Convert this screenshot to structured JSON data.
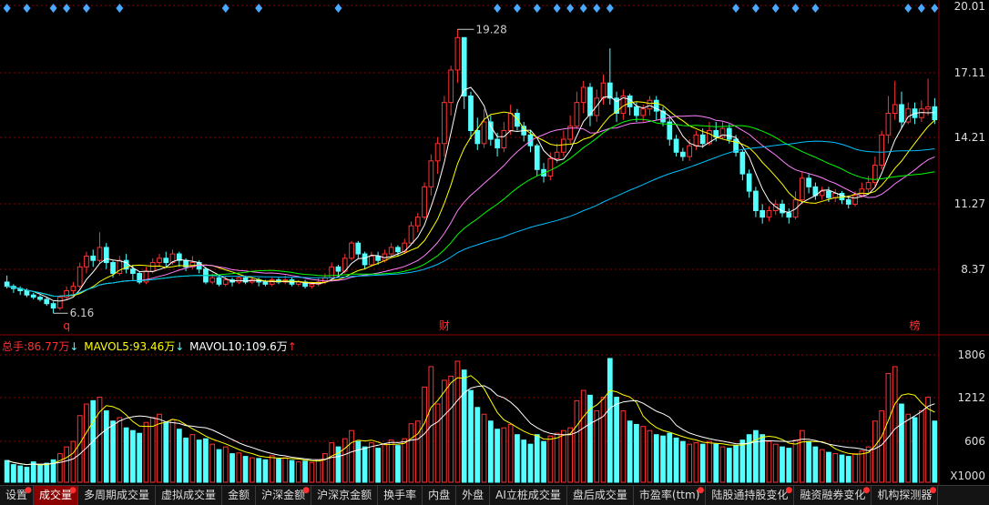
{
  "header": {
    "stock_name": "",
    "tag": ""
  },
  "price_axis": [
    "20.01",
    "17.11",
    "14.21",
    "11.27",
    "8.37"
  ],
  "volume_axis": [
    "1806",
    "1212",
    "606",
    "X1000"
  ],
  "markers": {
    "high": "19.28",
    "low": "6.16",
    "bottom_q": "q",
    "bottom_cai": "财",
    "bottom_bang": "榜"
  },
  "volume_info": {
    "total_label": "总手:",
    "total_value": "86.77万",
    "total_arrow": "↓",
    "mavol5_label": "MAVOL5:",
    "mavol5_value": "93.46万",
    "mavol5_arrow": "↓",
    "mavol10_label": "MAVOL10:",
    "mavol10_value": "109.6万",
    "mavol10_arrow": "↑"
  },
  "colors": {
    "up": "#ff3232",
    "down": "#54ffff",
    "ma5": "#ffffff",
    "ma10": "#ffff00",
    "ma20": "#ff80ff",
    "ma30": "#00ff00",
    "ma60": "#00bfff",
    "grid": "#8b0000",
    "diamond": "#4aa8ff"
  },
  "tabs": [
    {
      "label": "设置",
      "dot": true
    },
    {
      "label": "成交量",
      "dot": true,
      "active": true
    },
    {
      "label": "多周期成交量",
      "dot": false
    },
    {
      "label": "虚拟成交量",
      "dot": false
    },
    {
      "label": "金额",
      "dot": false
    },
    {
      "label": "沪深金额",
      "dot": true
    },
    {
      "label": "沪深京金额",
      "dot": false
    },
    {
      "label": "换手率",
      "dot": false
    },
    {
      "label": "内盘",
      "dot": false
    },
    {
      "label": "外盘",
      "dot": false
    },
    {
      "label": "AI立桩成交量",
      "dot": false
    },
    {
      "label": "盘后成交量",
      "dot": false
    },
    {
      "label": "市盈率(ttm)",
      "dot": true
    },
    {
      "label": "陆股通持股变化",
      "dot": true
    },
    {
      "label": "融资融券变化",
      "dot": true
    },
    {
      "label": "机构探测器",
      "dot": true
    }
  ],
  "chart_data": {
    "type": "candlestick",
    "price_range": [
      6.0,
      20.3
    ],
    "volume_range": [
      0,
      1900
    ],
    "candles": [
      [
        7.6,
        7.4,
        7.9,
        7.3,
        320
      ],
      [
        7.4,
        7.3,
        7.5,
        7.1,
        260
      ],
      [
        7.3,
        7.2,
        7.4,
        7.0,
        240
      ],
      [
        7.2,
        7.0,
        7.3,
        6.9,
        220
      ],
      [
        7.0,
        6.9,
        7.1,
        6.8,
        300
      ],
      [
        6.9,
        6.8,
        7.0,
        6.7,
        260
      ],
      [
        6.8,
        6.6,
        6.9,
        6.5,
        280
      ],
      [
        6.6,
        6.4,
        6.7,
        6.16,
        330
      ],
      [
        6.4,
        6.9,
        7.0,
        6.3,
        420
      ],
      [
        6.9,
        7.2,
        7.4,
        6.8,
        520
      ],
      [
        7.2,
        7.4,
        7.6,
        7.0,
        600
      ],
      [
        7.4,
        8.3,
        8.5,
        7.3,
        980
      ],
      [
        8.3,
        8.8,
        9.0,
        8.0,
        1150
      ],
      [
        8.8,
        8.6,
        9.1,
        8.3,
        1200
      ],
      [
        8.6,
        9.2,
        9.9,
        8.5,
        1250
      ],
      [
        9.2,
        8.5,
        9.4,
        8.2,
        1050
      ],
      [
        8.5,
        8.0,
        8.6,
        7.8,
        900
      ],
      [
        8.0,
        8.6,
        8.8,
        7.9,
        950
      ],
      [
        8.6,
        8.2,
        8.9,
        8.0,
        800
      ],
      [
        8.2,
        8.0,
        8.4,
        7.7,
        760
      ],
      [
        8.0,
        7.6,
        8.1,
        7.5,
        720
      ],
      [
        7.6,
        8.1,
        8.3,
        7.5,
        880
      ],
      [
        8.1,
        8.5,
        8.7,
        8.0,
        950
      ],
      [
        8.5,
        8.7,
        8.9,
        8.3,
        1000
      ],
      [
        8.7,
        8.5,
        9.0,
        8.3,
        880
      ],
      [
        8.5,
        8.9,
        9.1,
        8.4,
        920
      ],
      [
        8.9,
        8.6,
        9.0,
        8.3,
        780
      ],
      [
        8.6,
        8.3,
        8.7,
        8.1,
        650
      ],
      [
        8.3,
        8.5,
        8.8,
        8.2,
        700
      ],
      [
        8.5,
        8.2,
        8.6,
        8.0,
        620
      ],
      [
        8.2,
        7.6,
        8.3,
        7.5,
        640
      ],
      [
        7.6,
        7.8,
        8.0,
        7.5,
        560
      ],
      [
        7.8,
        7.5,
        7.9,
        7.4,
        480
      ],
      [
        7.5,
        7.7,
        7.9,
        7.4,
        520
      ],
      [
        7.7,
        7.6,
        7.8,
        7.4,
        420
      ],
      [
        7.6,
        7.8,
        7.9,
        7.5,
        430
      ],
      [
        7.8,
        7.6,
        7.9,
        7.5,
        380
      ],
      [
        7.6,
        7.7,
        7.8,
        7.5,
        360
      ],
      [
        7.7,
        7.6,
        7.8,
        7.4,
        350
      ],
      [
        7.6,
        7.5,
        7.7,
        7.4,
        330
      ],
      [
        7.5,
        7.7,
        7.8,
        7.4,
        390
      ],
      [
        7.7,
        7.6,
        7.8,
        7.5,
        340
      ],
      [
        7.6,
        7.7,
        7.9,
        7.5,
        360
      ],
      [
        7.7,
        7.5,
        7.8,
        7.4,
        320
      ],
      [
        7.5,
        7.6,
        7.7,
        7.4,
        300
      ],
      [
        7.6,
        7.4,
        7.7,
        7.3,
        310
      ],
      [
        7.4,
        7.5,
        7.6,
        7.3,
        290
      ],
      [
        7.5,
        7.6,
        7.8,
        7.4,
        330
      ],
      [
        7.6,
        7.8,
        8.0,
        7.5,
        420
      ],
      [
        7.8,
        8.3,
        8.5,
        7.7,
        580
      ],
      [
        8.3,
        8.1,
        8.4,
        7.9,
        520
      ],
      [
        8.1,
        8.7,
        8.9,
        8.0,
        640
      ],
      [
        8.7,
        9.4,
        9.5,
        8.6,
        760
      ],
      [
        9.4,
        8.9,
        9.5,
        8.7,
        600
      ],
      [
        8.9,
        8.4,
        9.0,
        8.2,
        520
      ],
      [
        8.4,
        8.8,
        9.0,
        8.3,
        580
      ],
      [
        8.8,
        8.6,
        9.0,
        8.4,
        500
      ],
      [
        8.6,
        8.9,
        9.1,
        8.5,
        560
      ],
      [
        8.9,
        9.2,
        9.4,
        8.8,
        620
      ],
      [
        9.2,
        9.0,
        9.3,
        8.8,
        540
      ],
      [
        9.0,
        9.4,
        9.6,
        8.9,
        640
      ],
      [
        9.4,
        10.2,
        10.4,
        9.3,
        860
      ],
      [
        10.2,
        10.6,
        10.8,
        9.9,
        900
      ],
      [
        10.6,
        12.0,
        12.2,
        10.5,
        1400
      ],
      [
        12.0,
        13.2,
        13.5,
        11.6,
        1700
      ],
      [
        13.2,
        14.0,
        14.3,
        12.6,
        1150
      ],
      [
        14.0,
        15.9,
        16.2,
        13.4,
        1500
      ],
      [
        15.9,
        17.4,
        17.6,
        15.3,
        1560
      ],
      [
        17.4,
        18.9,
        19.28,
        16.8,
        1780
      ],
      [
        18.9,
        16.2,
        18.9,
        15.6,
        1650
      ],
      [
        16.2,
        14.6,
        16.4,
        14.2,
        1350
      ],
      [
        14.6,
        14.0,
        15.2,
        13.7,
        1100
      ],
      [
        14.0,
        15.0,
        15.6,
        13.8,
        1000
      ],
      [
        15.0,
        14.2,
        15.3,
        13.9,
        900
      ],
      [
        14.2,
        13.8,
        14.5,
        13.4,
        780
      ],
      [
        13.8,
        14.6,
        15.0,
        13.6,
        800
      ],
      [
        14.6,
        15.4,
        15.8,
        14.4,
        850
      ],
      [
        15.4,
        14.8,
        15.6,
        14.6,
        700
      ],
      [
        14.8,
        14.4,
        15.0,
        14.1,
        620
      ],
      [
        14.4,
        13.9,
        14.6,
        13.6,
        560
      ],
      [
        13.9,
        12.8,
        14.0,
        12.5,
        700
      ],
      [
        12.8,
        12.5,
        13.1,
        12.2,
        600
      ],
      [
        12.5,
        13.3,
        13.6,
        12.3,
        680
      ],
      [
        13.3,
        13.6,
        14.0,
        13.1,
        720
      ],
      [
        13.6,
        14.2,
        14.6,
        13.4,
        760
      ],
      [
        14.2,
        14.8,
        15.3,
        14.0,
        800
      ],
      [
        14.8,
        15.9,
        16.4,
        14.7,
        1200
      ],
      [
        15.9,
        16.6,
        16.9,
        15.4,
        1350
      ],
      [
        16.6,
        15.3,
        16.8,
        14.8,
        1280
      ],
      [
        15.3,
        16.1,
        16.5,
        15.0,
        1050
      ],
      [
        16.1,
        16.8,
        17.2,
        15.8,
        1250
      ],
      [
        16.8,
        16.1,
        18.4,
        15.8,
        1820
      ],
      [
        16.1,
        15.4,
        16.4,
        15.0,
        1250
      ],
      [
        15.4,
        16.2,
        16.5,
        15.1,
        1050
      ],
      [
        16.2,
        15.7,
        16.3,
        15.3,
        900
      ],
      [
        15.7,
        15.3,
        15.9,
        15.0,
        850
      ],
      [
        15.3,
        15.6,
        15.8,
        15.0,
        820
      ],
      [
        15.6,
        16.0,
        16.2,
        15.3,
        760
      ],
      [
        16.0,
        15.5,
        16.2,
        15.1,
        700
      ],
      [
        15.5,
        15.0,
        15.7,
        14.8,
        680
      ],
      [
        15.0,
        14.2,
        15.2,
        13.9,
        720
      ],
      [
        14.2,
        13.6,
        14.4,
        13.4,
        650
      ],
      [
        13.6,
        13.4,
        13.8,
        13.2,
        600
      ],
      [
        13.4,
        13.9,
        14.2,
        13.2,
        560
      ],
      [
        13.9,
        14.4,
        14.6,
        13.7,
        580
      ],
      [
        14.4,
        14.0,
        14.7,
        13.8,
        560
      ],
      [
        14.0,
        14.6,
        15.0,
        13.9,
        600
      ],
      [
        14.6,
        14.3,
        15.0,
        14.1,
        560
      ],
      [
        14.3,
        14.7,
        15.0,
        14.2,
        520
      ],
      [
        14.7,
        14.2,
        14.9,
        14.0,
        500
      ],
      [
        14.2,
        13.6,
        14.4,
        13.4,
        540
      ],
      [
        13.6,
        12.6,
        13.7,
        12.3,
        620
      ],
      [
        12.6,
        11.8,
        12.8,
        11.5,
        700
      ],
      [
        11.8,
        10.9,
        12.0,
        10.6,
        760
      ],
      [
        10.9,
        10.6,
        11.2,
        10.3,
        700
      ],
      [
        10.6,
        10.9,
        11.1,
        10.4,
        600
      ],
      [
        10.9,
        11.2,
        11.4,
        10.7,
        560
      ],
      [
        11.2,
        10.8,
        11.4,
        10.6,
        520
      ],
      [
        10.8,
        10.6,
        11.0,
        10.3,
        500
      ],
      [
        10.6,
        11.4,
        11.8,
        10.5,
        620
      ],
      [
        11.4,
        12.4,
        12.7,
        11.2,
        760
      ],
      [
        12.4,
        12.0,
        12.6,
        11.7,
        600
      ],
      [
        12.0,
        11.6,
        12.2,
        11.4,
        520
      ],
      [
        11.6,
        11.8,
        12.0,
        11.4,
        480
      ],
      [
        11.8,
        11.5,
        12.0,
        11.3,
        440
      ],
      [
        11.5,
        11.7,
        11.9,
        11.3,
        420
      ],
      [
        11.7,
        11.4,
        11.8,
        11.2,
        400
      ],
      [
        11.4,
        11.2,
        11.6,
        11.0,
        380
      ],
      [
        11.2,
        11.6,
        11.8,
        11.1,
        420
      ],
      [
        11.6,
        11.9,
        12.2,
        11.5,
        460
      ],
      [
        11.9,
        12.2,
        12.5,
        11.7,
        520
      ],
      [
        12.2,
        13.0,
        13.4,
        12.0,
        900
      ],
      [
        13.0,
        14.4,
        14.6,
        12.8,
        1050
      ],
      [
        14.4,
        15.4,
        16.2,
        14.0,
        1600
      ],
      [
        15.4,
        15.8,
        16.9,
        15.1,
        1700
      ],
      [
        15.8,
        15.0,
        16.4,
        14.7,
        1150
      ],
      [
        15.0,
        15.6,
        15.9,
        14.9,
        1000
      ],
      [
        15.6,
        15.2,
        15.9,
        14.9,
        950
      ],
      [
        15.2,
        15.6,
        16.0,
        15.0,
        1050
      ],
      [
        15.6,
        15.7,
        17.0,
        15.3,
        1250
      ],
      [
        15.7,
        15.1,
        16.1,
        14.9,
        900
      ]
    ]
  }
}
